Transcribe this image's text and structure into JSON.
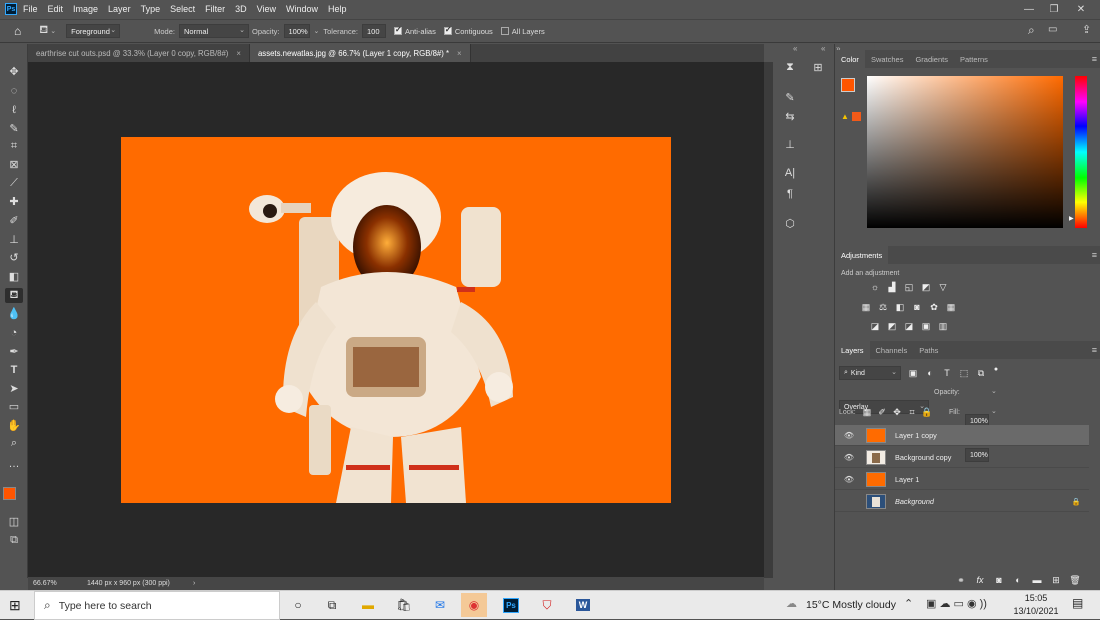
{
  "menubar": {
    "app_icon": "Ps",
    "items": [
      "File",
      "Edit",
      "Image",
      "Layer",
      "Type",
      "Select",
      "Filter",
      "3D",
      "View",
      "Window",
      "Help"
    ],
    "window_controls": {
      "minimize": "—",
      "restore": "❐",
      "close": "✕"
    }
  },
  "options_bar": {
    "home_icon": "home-icon",
    "fill_source": "Foreground",
    "mode_label": "Mode:",
    "mode_value": "Normal",
    "opacity_label": "Opacity:",
    "opacity_value": "100%",
    "tolerance_label": "Tolerance:",
    "tolerance_value": "100",
    "antialias_label": "Anti-alias",
    "antialias_checked": true,
    "contiguous_label": "Contiguous",
    "contiguous_checked": true,
    "all_layers_label": "All Layers",
    "all_layers_checked": false
  },
  "tabs": [
    {
      "label": "earthrise cut outs.psd @ 33.3% (Layer 0 copy, RGB/8#)",
      "close": "×",
      "active": false
    },
    {
      "label": "assets.newatlas.jpg @ 66.7% (Layer 1 copy, RGB/8#) *",
      "close": "×",
      "active": true
    }
  ],
  "status": {
    "zoom": "66.67%",
    "doc_info": "1440 px x 960 px (300 ppi)",
    "arrow": "›"
  },
  "canvas": {
    "background_color": "#ff6b00"
  },
  "color_panel": {
    "tabs": [
      "Color",
      "Swatches",
      "Gradients",
      "Patterns"
    ],
    "foreground": "#ff5500",
    "background": "#ffffff",
    "hue_color": "#ff6a00"
  },
  "adjustments": {
    "title": "Adjustments",
    "hint": "Add an adjustment"
  },
  "layers_panel": {
    "tabs": [
      "Layers",
      "Channels",
      "Paths"
    ],
    "kind_label": "Kind",
    "blend_mode": "Overlay",
    "opacity_label": "Opacity:",
    "opacity_value": "100%",
    "lock_label": "Lock:",
    "fill_label": "Fill:",
    "fill_value": "100%",
    "layers": [
      {
        "name": "Layer 1 copy",
        "visible": true,
        "selected": true,
        "thumb": "orange"
      },
      {
        "name": "Background copy",
        "visible": true,
        "selected": false,
        "thumb": "astronaut"
      },
      {
        "name": "Layer 1",
        "visible": true,
        "selected": false,
        "thumb": "orange"
      },
      {
        "name": "Background",
        "visible": false,
        "selected": false,
        "thumb": "astronaut",
        "italic": true,
        "locked": true
      }
    ]
  },
  "taskbar": {
    "search_placeholder": "Type here to search",
    "weather": "15°C  Mostly cloudy",
    "time": "15:05",
    "date": "13/10/2021"
  }
}
